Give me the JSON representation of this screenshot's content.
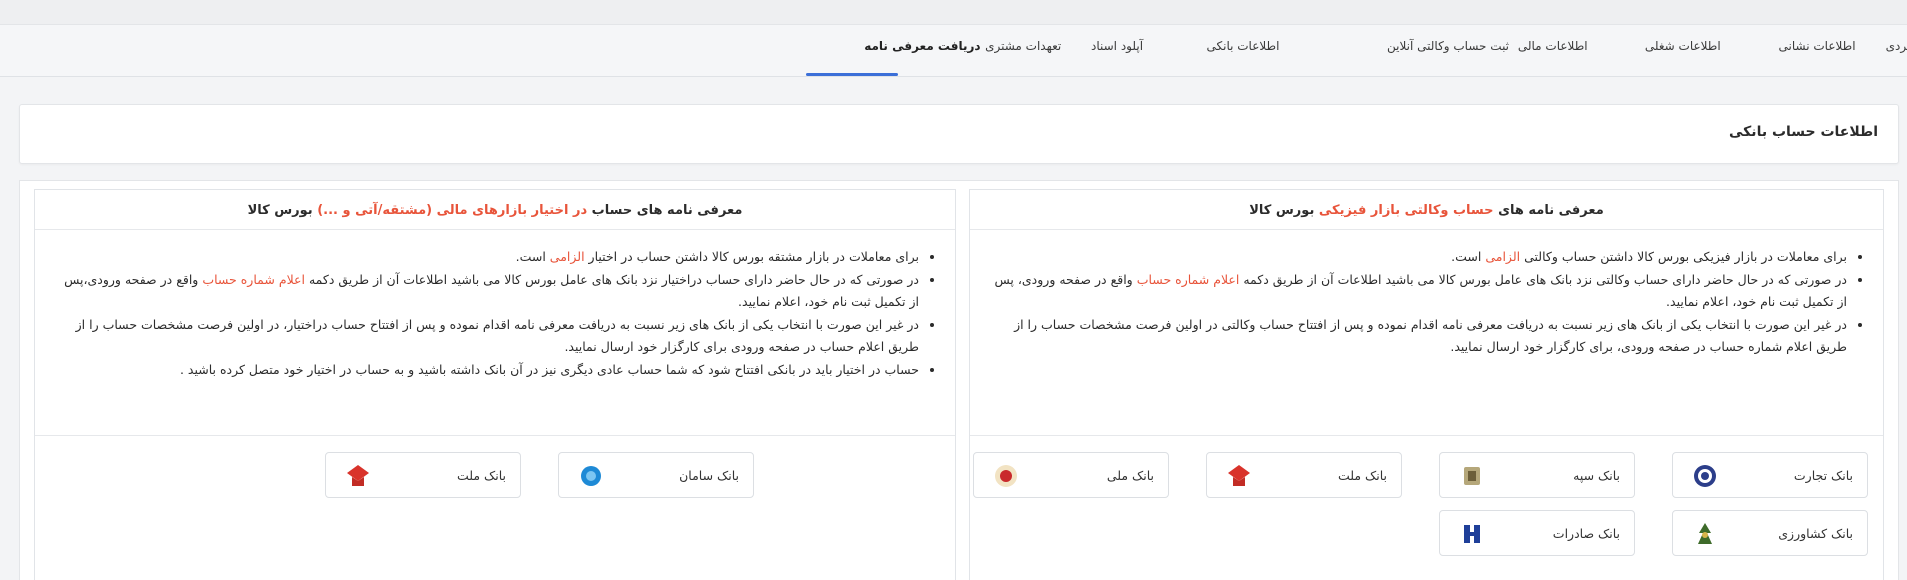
{
  "tabs": [
    {
      "label": "مشخصات فردی"
    },
    {
      "label": "اطلاعات نشانی"
    },
    {
      "label": "اطلاعات شغلی"
    },
    {
      "label": "اطلاعات مالی"
    },
    {
      "label": "ثبت حساب وکالتی آنلاین"
    },
    {
      "label": "اطلاعات بانکی"
    },
    {
      "label": "آپلود اسناد"
    },
    {
      "label": "تعهدات مشتری"
    },
    {
      "label": "دریافت معرفی نامه",
      "active": true
    }
  ],
  "section_title": "اطلاعات حساب بانکی",
  "physical": {
    "title_pre": "معرفی نامه های",
    "title_hl": "حساب وکالتی بازار فیزیکی",
    "title_post": "بورس کالا",
    "bullet1_a": "برای معاملات در بازار فیزیکی بورس کالا داشتن حساب وکالتی",
    "bullet1_hl": "الزامی",
    "bullet1_b": "است.",
    "bullet2_a": "در صورتی که در حال حاضر دارای حساب وکالتی نزد بانک های عامل بورس کالا می باشید اطلاعات آن از طریق دکمه",
    "bullet2_hl": "اعلام شماره حساب",
    "bullet2_b": "واقع در صفحه ورودی، پس از تکمیل ثبت نام خود، اعلام نمایید.",
    "bullet3": "در غیر این صورت با انتخاب یکی از بانک های زیر نسبت به دریافت معرفی نامه اقدام نموده و پس از افتتاح حساب وکالتی در اولین فرصت مشخصات حساب را از طریق اعلام شماره حساب در صفحه ورودی، برای کارگزار خود ارسال نمایید.",
    "banks": [
      {
        "name": "بانک تجارت",
        "logo": "tejarat-logo"
      },
      {
        "name": "بانک سپه",
        "logo": "sepah-logo"
      },
      {
        "name": "بانک ملت",
        "logo": "mellat-logo"
      },
      {
        "name": "بانک ملی",
        "logo": "melli-logo"
      },
      {
        "name": "بانک کشاورزی",
        "logo": "keshavarzi-logo"
      },
      {
        "name": "بانک صادرات",
        "logo": "saderat-logo"
      }
    ]
  },
  "derivatives": {
    "title_pre": "معرفی نامه های حساب",
    "title_hl": "در اختیار بازارهای مالی (مشتقه/آتی و ...)",
    "title_post": "بورس کالا",
    "bullet1_a": "برای معاملات در بازار مشتقه بورس کالا داشتن حساب در اختیار",
    "bullet1_hl": "الزامی",
    "bullet1_b": "است.",
    "bullet2_a": "در صورتی که در حال حاضر دارای حساب دراختیار نزد بانک های عامل بورس کالا می باشید اطلاعات آن از طریق دکمه",
    "bullet2_hl": "اعلام شماره حساب",
    "bullet2_b": "واقع در صفحه ورودی،پس از تکمیل ثبت نام خود، اعلام نمایید.",
    "bullet3": "در غیر این صورت با انتخاب یکی از بانک های زیر نسبت به دریافت معرفی نامه اقدام نموده و پس از افتتاح حساب دراختیار، در اولین فرصت مشخصات حساب را از طریق اعلام حساب در صفحه ورودی برای کارگزار خود ارسال نمایید.",
    "bullet4": "حساب در اختیار باید در بانکی افتتاح شود که شما حساب عادی دیگری نیز در آن بانک داشته باشید و به حساب در اختیار خود متصل کرده باشید .",
    "banks": [
      {
        "name": "بانک سامان",
        "logo": "saman-logo"
      },
      {
        "name": "بانک ملت",
        "logo": "mellat-logo"
      }
    ]
  },
  "colors": {
    "accent": "#3b6fd8",
    "highlight": "#e8543a"
  }
}
